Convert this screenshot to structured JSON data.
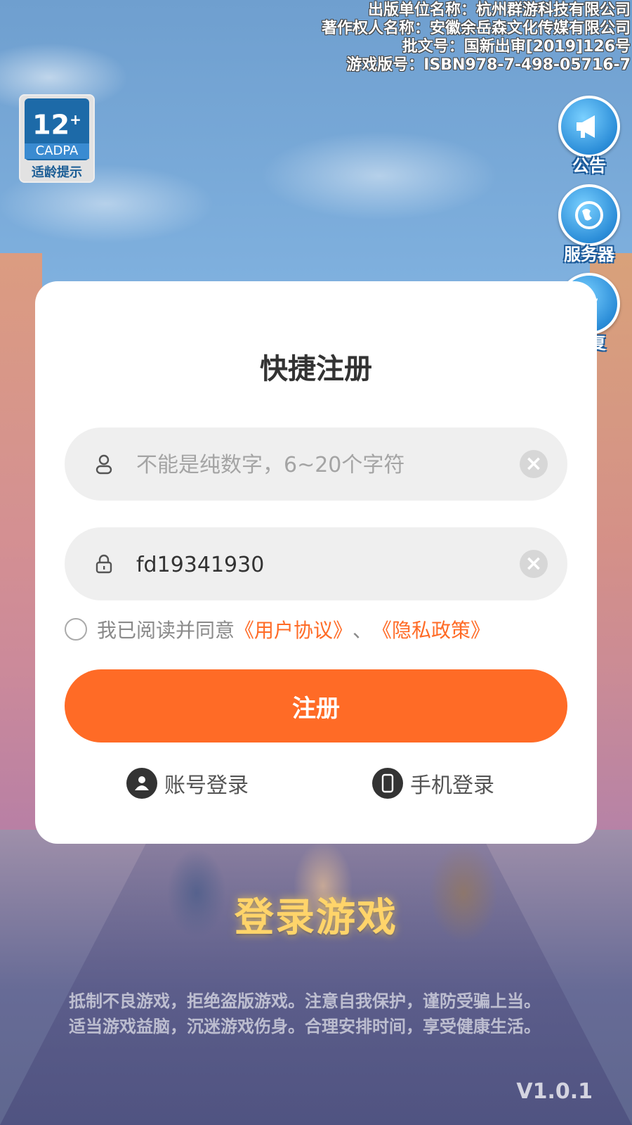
{
  "publisher": {
    "line1": "出版单位名称：杭州群游科技有限公司",
    "line2": "著作权人名称：安徽余岳森文化传媒有限公司",
    "line3": "批文号：国新出审[2019]126号",
    "line4": "游戏版号：ISBN978-7-498-05716-7"
  },
  "age_badge": {
    "number": "12",
    "plus": "+",
    "cadpa": "CADPA",
    "label": "适龄提示"
  },
  "side_buttons": {
    "announcement": "公告",
    "server": "服务器",
    "repair": "修复"
  },
  "modal": {
    "title": "快捷注册",
    "username_placeholder": "不能是纯数字，6~20个字符",
    "password_value": "fd19341930",
    "agree_prefix": "我已阅读并同意",
    "user_agreement": "《用户协议》",
    "separator": "、",
    "privacy_policy": "《隐私政策》",
    "register_label": "注册",
    "account_login": "账号登录",
    "phone_login": "手机登录"
  },
  "footer": {
    "game_title": "登录游戏",
    "notice_line1": "抵制不良游戏，拒绝盗版游戏。注意自我保护，谨防受骗上当。",
    "notice_line2": "适当游戏益脑，沉迷游戏伤身。合理安排时间，享受健康生活。",
    "version": "V1.0.1"
  },
  "colors": {
    "accent": "#ff6b26",
    "field_bg": "#efefef"
  },
  "icons": {
    "username": "user-icon",
    "password": "lock-icon",
    "clear": "clear-icon",
    "account": "account-icon",
    "phone": "phone-icon",
    "announcement": "megaphone-icon",
    "server": "globe-icon",
    "repair": "wrench-icon"
  }
}
